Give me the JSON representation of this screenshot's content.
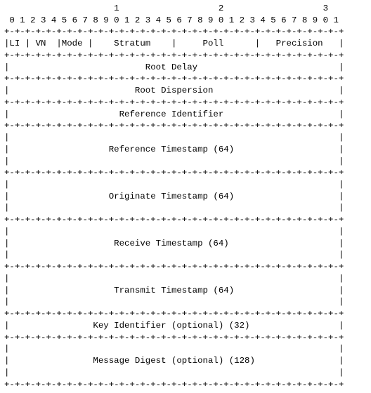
{
  "ruler": {
    "tens": "                     1                   2                   3",
    "units": " 0 1 2 3 4 5 6 7 8 9 0 1 2 3 4 5 6 7 8 9 0 1 2 3 4 5 6 7 8 9 0 1"
  },
  "sep": "+-+-+-+-+-+-+-+-+-+-+-+-+-+-+-+-+-+-+-+-+-+-+-+-+-+-+-+-+-+-+-+-+",
  "blank_row": "|                                                               |",
  "row0": {
    "li": "LI",
    "vn": "VN",
    "mode": "Mode",
    "stratum": "Stratum",
    "poll": "Poll",
    "precision": "Precision"
  },
  "rows": {
    "root_delay": "Root Delay",
    "root_dispersion": "Root Dispersion",
    "ref_id": "Reference Identifier",
    "ref_ts": "Reference Timestamp (64)",
    "orig_ts": "Originate Timestamp (64)",
    "recv_ts": "Receive Timestamp (64)",
    "xmit_ts": "Transmit Timestamp (64)",
    "key_id": "Key Identifier (optional) (32)",
    "digest": "Message Digest (optional) (128)"
  }
}
